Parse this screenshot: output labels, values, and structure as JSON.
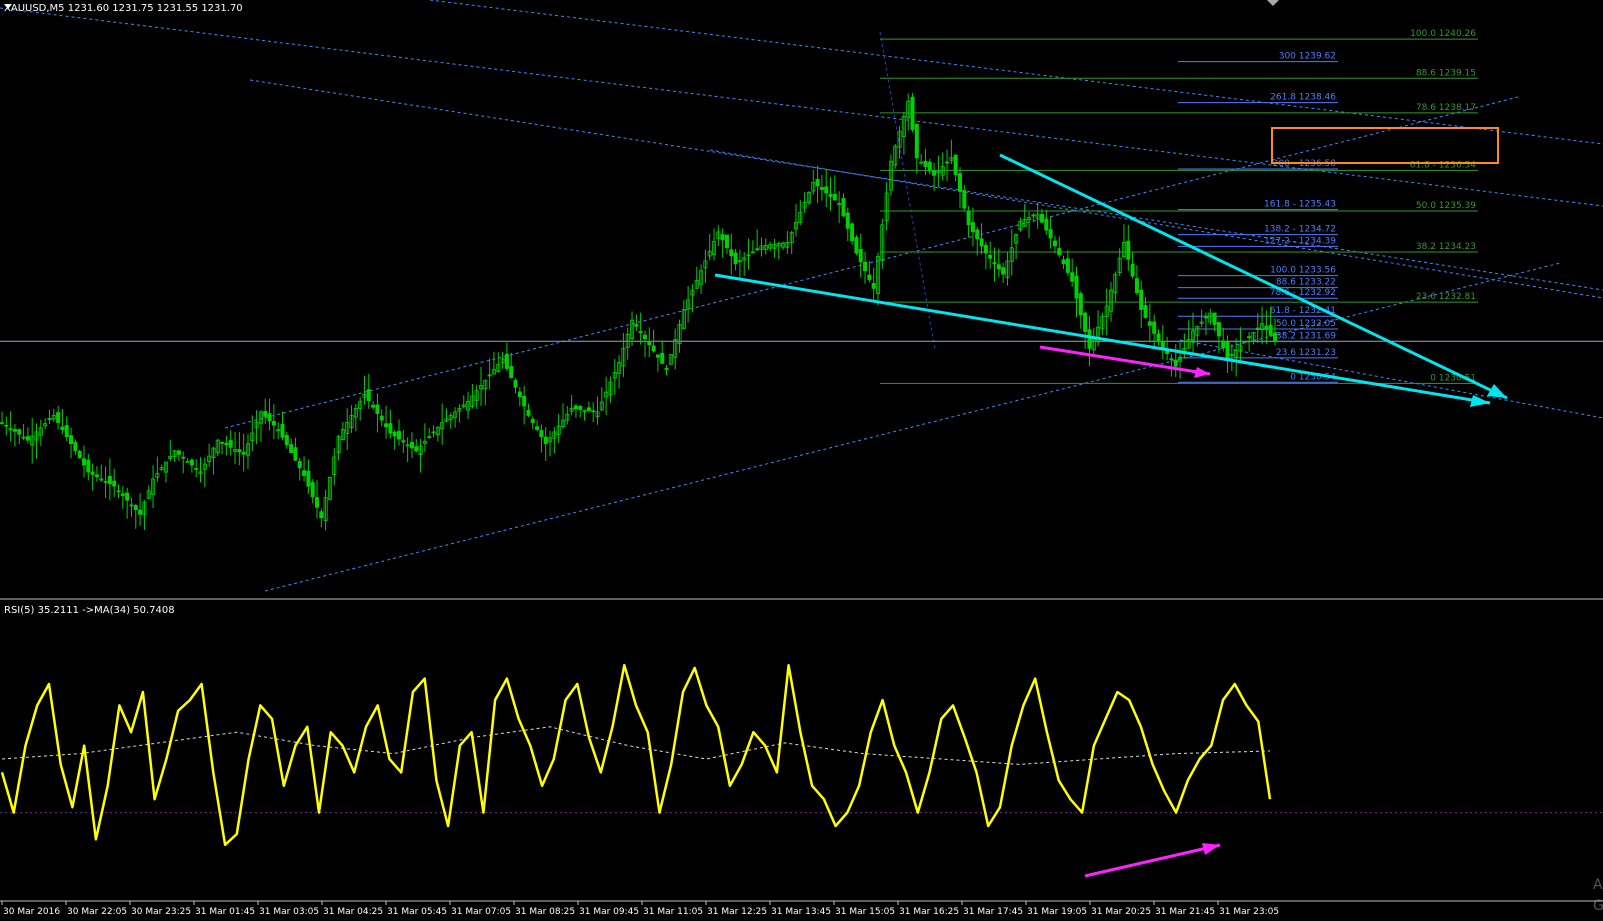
{
  "window": {
    "symbol_line": "XAUUSD,M5  1231.60 1231.75 1231.55 1231.70",
    "corner_partial_1": "A",
    "corner_partial_2": "G"
  },
  "colors": {
    "background": "#000000",
    "candle": "#00d000",
    "fib_green": "#2f9a2f",
    "fib_blue": "#4a7dff",
    "channel": "#3d8bff",
    "trend_cyan": "#00e5ee",
    "arrow_magenta": "#ff22ff",
    "rsi_line": "#ffff00",
    "rsi_ma": "#dddddd",
    "highlight": "#ff8c1a",
    "axis_text": "#ffffff"
  },
  "chart_data": [
    {
      "type": "candlestick",
      "title": "XAUUSD,M5  1231.60 1231.75 1231.55 1231.70",
      "ylim": [
        1224.6,
        1240.8
      ],
      "x_index_range": [
        0,
        295
      ],
      "close_path": [
        [
          0,
          1229.4
        ],
        [
          6,
          1228.9
        ],
        [
          12,
          1229.6
        ],
        [
          20,
          1228.0
        ],
        [
          26,
          1227.6
        ],
        [
          32,
          1226.8
        ],
        [
          35,
          1227.8
        ],
        [
          40,
          1228.6
        ],
        [
          46,
          1228.0
        ],
        [
          50,
          1228.9
        ],
        [
          56,
          1228.5
        ],
        [
          60,
          1229.7
        ],
        [
          64,
          1229.2
        ],
        [
          70,
          1227.9
        ],
        [
          74,
          1226.7
        ],
        [
          78,
          1229.0
        ],
        [
          84,
          1230.2
        ],
        [
          90,
          1229.1
        ],
        [
          96,
          1228.6
        ],
        [
          102,
          1229.4
        ],
        [
          108,
          1230.0
        ],
        [
          116,
          1231.2
        ],
        [
          122,
          1229.6
        ],
        [
          126,
          1228.8
        ],
        [
          132,
          1229.8
        ],
        [
          138,
          1229.7
        ],
        [
          143,
          1231.1
        ],
        [
          146,
          1232.3
        ],
        [
          150,
          1231.6
        ],
        [
          154,
          1230.9
        ],
        [
          158,
          1232.6
        ],
        [
          162,
          1233.7
        ],
        [
          166,
          1234.8
        ],
        [
          170,
          1233.9
        ],
        [
          176,
          1234.4
        ],
        [
          182,
          1234.5
        ],
        [
          188,
          1236.2
        ],
        [
          194,
          1235.6
        ],
        [
          198,
          1234.2
        ],
        [
          202,
          1233.2
        ],
        [
          206,
          1236.8
        ],
        [
          210,
          1238.5
        ],
        [
          212,
          1236.9
        ],
        [
          216,
          1236.4
        ],
        [
          220,
          1236.9
        ],
        [
          224,
          1235.0
        ],
        [
          228,
          1234.2
        ],
        [
          232,
          1233.6
        ],
        [
          236,
          1235.1
        ],
        [
          240,
          1235.3
        ],
        [
          244,
          1234.4
        ],
        [
          248,
          1233.4
        ],
        [
          252,
          1231.5
        ],
        [
          256,
          1232.7
        ],
        [
          260,
          1234.5
        ],
        [
          264,
          1232.6
        ],
        [
          268,
          1231.7
        ],
        [
          272,
          1231.0
        ],
        [
          276,
          1232.0
        ],
        [
          280,
          1232.5
        ],
        [
          284,
          1231.2
        ],
        [
          288,
          1231.7
        ],
        [
          292,
          1232.2
        ],
        [
          295,
          1231.7
        ]
      ],
      "tick_labels": [
        "30 Mar 2016",
        "30 Mar 22:05",
        "30 Mar 23:25",
        "31 Mar 01:45",
        "31 Mar 03:05",
        "31 Mar 04:25",
        "31 Mar 05:45",
        "31 Mar 07:05",
        "31 Mar 08:25",
        "31 Mar 09:45",
        "31 Mar 11:05",
        "31 Mar 12:25",
        "31 Mar 13:45",
        "31 Mar 15:05",
        "31 Mar 16:25",
        "31 Mar 17:45",
        "31 Mar 19:05",
        "31 Mar 20:25",
        "31 Mar 21:45",
        "31 Mar 23:05"
      ],
      "current_price": 1231.7,
      "fib_retracement_green": [
        {
          "label": "100.0 1240.26",
          "price": 1240.26
        },
        {
          "label": "88.6 1239.15",
          "price": 1239.15
        },
        {
          "label": "78.6 1238.17",
          "price": 1238.17
        },
        {
          "label": "61.8 - 1236.54",
          "price": 1236.54
        },
        {
          "label": "50.0 1235.39",
          "price": 1235.39
        },
        {
          "label": "38.2 1234.23",
          "price": 1234.23
        },
        {
          "label": "23.6 1232.81",
          "price": 1232.81
        },
        {
          "label": "0 1230.51",
          "price": 1230.51
        }
      ],
      "fib_extension_blue": [
        {
          "label": "300 1239.62",
          "price": 1239.62
        },
        {
          "label": "261.8 1238.46",
          "price": 1238.46
        },
        {
          "label": "200 - 1236.58",
          "price": 1236.58
        },
        {
          "label": "161.8 - 1235.43",
          "price": 1235.43
        },
        {
          "label": "138.2 - 1234.72",
          "price": 1234.72
        },
        {
          "label": "127.2 - 1234.39",
          "price": 1234.39
        },
        {
          "label": "100.0 1233.56",
          "price": 1233.56
        },
        {
          "label": "88.6 1233.22",
          "price": 1233.22
        },
        {
          "label": "78.6 - 1232.92",
          "price": 1232.92
        },
        {
          "label": "61.8 - 1232.41",
          "price": 1232.41
        },
        {
          "label": "50.0 1232.05",
          "price": 1232.05
        },
        {
          "label": "38.2 1231.69",
          "price": 1231.69
        },
        {
          "label": "23.6 1231.23",
          "price": 1231.23
        },
        {
          "label": "0 1230.54",
          "price": 1230.54
        }
      ],
      "highlighted_level": "200 - 1236.58"
    },
    {
      "type": "line",
      "title": "RSI(5) 35.2111  ->MA(34) 50.7408",
      "ylim": [
        0,
        100
      ],
      "rsi_path": [
        [
          0,
          45
        ],
        [
          3,
          30
        ],
        [
          6,
          55
        ],
        [
          9,
          70
        ],
        [
          12,
          78
        ],
        [
          15,
          48
        ],
        [
          18,
          32
        ],
        [
          21,
          55
        ],
        [
          24,
          20
        ],
        [
          27,
          40
        ],
        [
          30,
          70
        ],
        [
          33,
          60
        ],
        [
          36,
          75
        ],
        [
          39,
          35
        ],
        [
          42,
          50
        ],
        [
          45,
          68
        ],
        [
          48,
          72
        ],
        [
          51,
          78
        ],
        [
          54,
          45
        ],
        [
          57,
          18
        ],
        [
          60,
          22
        ],
        [
          63,
          50
        ],
        [
          66,
          70
        ],
        [
          69,
          65
        ],
        [
          72,
          40
        ],
        [
          75,
          55
        ],
        [
          78,
          62
        ],
        [
          81,
          30
        ],
        [
          84,
          60
        ],
        [
          87,
          55
        ],
        [
          90,
          45
        ],
        [
          93,
          62
        ],
        [
          96,
          70
        ],
        [
          99,
          50
        ],
        [
          102,
          45
        ],
        [
          105,
          75
        ],
        [
          108,
          80
        ],
        [
          111,
          42
        ],
        [
          114,
          25
        ],
        [
          117,
          55
        ],
        [
          120,
          60
        ],
        [
          123,
          30
        ],
        [
          126,
          72
        ],
        [
          129,
          80
        ],
        [
          132,
          65
        ],
        [
          135,
          55
        ],
        [
          138,
          40
        ],
        [
          141,
          50
        ],
        [
          144,
          72
        ],
        [
          147,
          78
        ],
        [
          150,
          58
        ],
        [
          153,
          45
        ],
        [
          156,
          62
        ],
        [
          159,
          85
        ],
        [
          162,
          70
        ],
        [
          165,
          60
        ],
        [
          168,
          30
        ],
        [
          171,
          48
        ],
        [
          174,
          75
        ],
        [
          177,
          84
        ],
        [
          180,
          70
        ],
        [
          183,
          62
        ],
        [
          186,
          40
        ],
        [
          189,
          48
        ],
        [
          192,
          60
        ],
        [
          195,
          55
        ],
        [
          198,
          45
        ],
        [
          201,
          85
        ],
        [
          204,
          60
        ],
        [
          207,
          40
        ],
        [
          210,
          35
        ],
        [
          213,
          25
        ],
        [
          216,
          30
        ],
        [
          219,
          40
        ],
        [
          222,
          60
        ],
        [
          225,
          72
        ],
        [
          228,
          55
        ],
        [
          231,
          45
        ],
        [
          234,
          30
        ],
        [
          237,
          45
        ],
        [
          240,
          65
        ],
        [
          243,
          70
        ],
        [
          246,
          58
        ],
        [
          249,
          45
        ],
        [
          252,
          25
        ],
        [
          255,
          32
        ],
        [
          258,
          55
        ],
        [
          261,
          70
        ],
        [
          264,
          80
        ],
        [
          267,
          60
        ],
        [
          270,
          42
        ],
        [
          273,
          35
        ],
        [
          276,
          30
        ],
        [
          279,
          55
        ],
        [
          282,
          65
        ],
        [
          285,
          75
        ],
        [
          288,
          72
        ],
        [
          291,
          62
        ],
        [
          294,
          48
        ],
        [
          297,
          38
        ],
        [
          300,
          30
        ],
        [
          303,
          42
        ],
        [
          306,
          50
        ],
        [
          309,
          55
        ],
        [
          312,
          72
        ],
        [
          315,
          78
        ],
        [
          318,
          70
        ],
        [
          321,
          64
        ],
        [
          324,
          35
        ]
      ],
      "ma_path": [
        [
          0,
          50
        ],
        [
          20,
          52
        ],
        [
          40,
          56
        ],
        [
          60,
          60
        ],
        [
          80,
          55
        ],
        [
          100,
          52
        ],
        [
          120,
          58
        ],
        [
          140,
          62
        ],
        [
          160,
          55
        ],
        [
          180,
          50
        ],
        [
          200,
          56
        ],
        [
          220,
          52
        ],
        [
          240,
          50
        ],
        [
          260,
          48
        ],
        [
          280,
          50
        ],
        [
          300,
          52
        ],
        [
          324,
          53
        ]
      ],
      "x_index_range": [
        0,
        324
      ]
    }
  ]
}
